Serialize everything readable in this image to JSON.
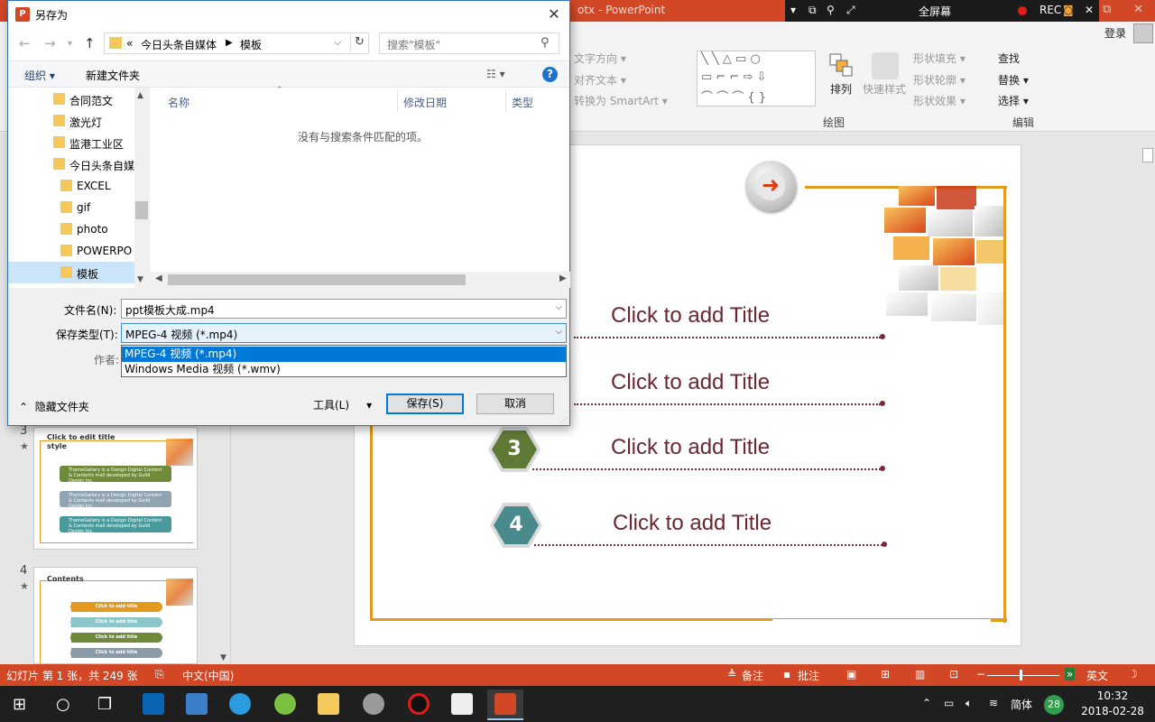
{
  "powerpoint": {
    "window_title": "otx - PowerPoint",
    "rec_bar": {
      "fullscreen": "全屏幕",
      "rec": "REC"
    },
    "login": "登录",
    "ribbon": {
      "text_direction": "文字方向 ▾",
      "align_text": "对齐文本 ▾",
      "convert_smartart": "转换为 SmartArt ▾",
      "arrange": "排列",
      "quick_styles": "快速样式",
      "shape_fill": "形状填充 ▾",
      "shape_outline": "形状轮廓 ▾",
      "shape_effects": "形状效果 ▾",
      "find": "查找",
      "replace": "替换 ▾",
      "select": "选择 ▾",
      "group_drawing": "绘图",
      "group_editing": "编辑"
    },
    "thumbnails": [
      {
        "num": "3",
        "star": "★",
        "title": "Click to edit title style",
        "bars": [
          "ThemeGallery is a Design Digital Content & Contents mall developed by Guild Design Inc.",
          "ThemeGallery is a Design Digital Content & Contents mall developed by Guild Design Inc.",
          "ThemeGallery is a Design Digital Content & Contents mall developed by Guild Design Inc."
        ]
      },
      {
        "num": "4",
        "star": "★",
        "title": "Contents",
        "items": [
          "Click to add title",
          "Click to add title",
          "Click to add title",
          "Click to add title"
        ]
      }
    ],
    "slide": {
      "arrow": "➜",
      "items": [
        {
          "num": "",
          "title": "Click to add Title"
        },
        {
          "num": "",
          "title": "Click to add Title"
        },
        {
          "num": "3",
          "title": "Click to add Title"
        },
        {
          "num": "4",
          "title": "Click to add Title"
        }
      ]
    },
    "status": {
      "slide_info": "幻灯片 第 1 张，共 249 张",
      "language": "中文(中国)",
      "notes": "备注",
      "comments": "批注",
      "ime": "英文"
    }
  },
  "dialog": {
    "title": "另存为",
    "breadcrumb": [
      "今日头条自媒体",
      "模板"
    ],
    "breadcrumb_prefix": "«",
    "search_placeholder": "搜索\"模板\"",
    "toolbar": {
      "organize": "组织 ▾",
      "new_folder": "新建文件夹"
    },
    "tree": [
      "合同范文",
      "激光灯",
      "监港工业区",
      "今日头条自媒",
      "EXCEL",
      "gif",
      "photo",
      "POWERPO",
      "模板"
    ],
    "tree_selected": "模板",
    "columns": {
      "name": "名称",
      "modified": "修改日期",
      "type": "类型"
    },
    "empty_message": "没有与搜索条件匹配的项。",
    "filename_label": "文件名(N):",
    "filename_value": "ppt模板大成.mp4",
    "filetype_label": "保存类型(T):",
    "filetype_value": "MPEG-4 视频 (*.mp4)",
    "filetype_options": [
      "MPEG-4 视频 (*.mp4)",
      "Windows Media 视频 (*.wmv)"
    ],
    "author_label": "作者:",
    "hide_folders": "隐藏文件夹",
    "tools": "工具(L)",
    "save": "保存(S)",
    "cancel": "取消"
  },
  "taskbar": {
    "ime_lang": "简体",
    "badge": "28",
    "time": "10:32",
    "date": "2018-02-28"
  },
  "colors": {
    "pp_accent": "#d24726",
    "slide_frame": "#e39a1e",
    "title_text": "#6b2630",
    "selection": "#0078d7"
  }
}
